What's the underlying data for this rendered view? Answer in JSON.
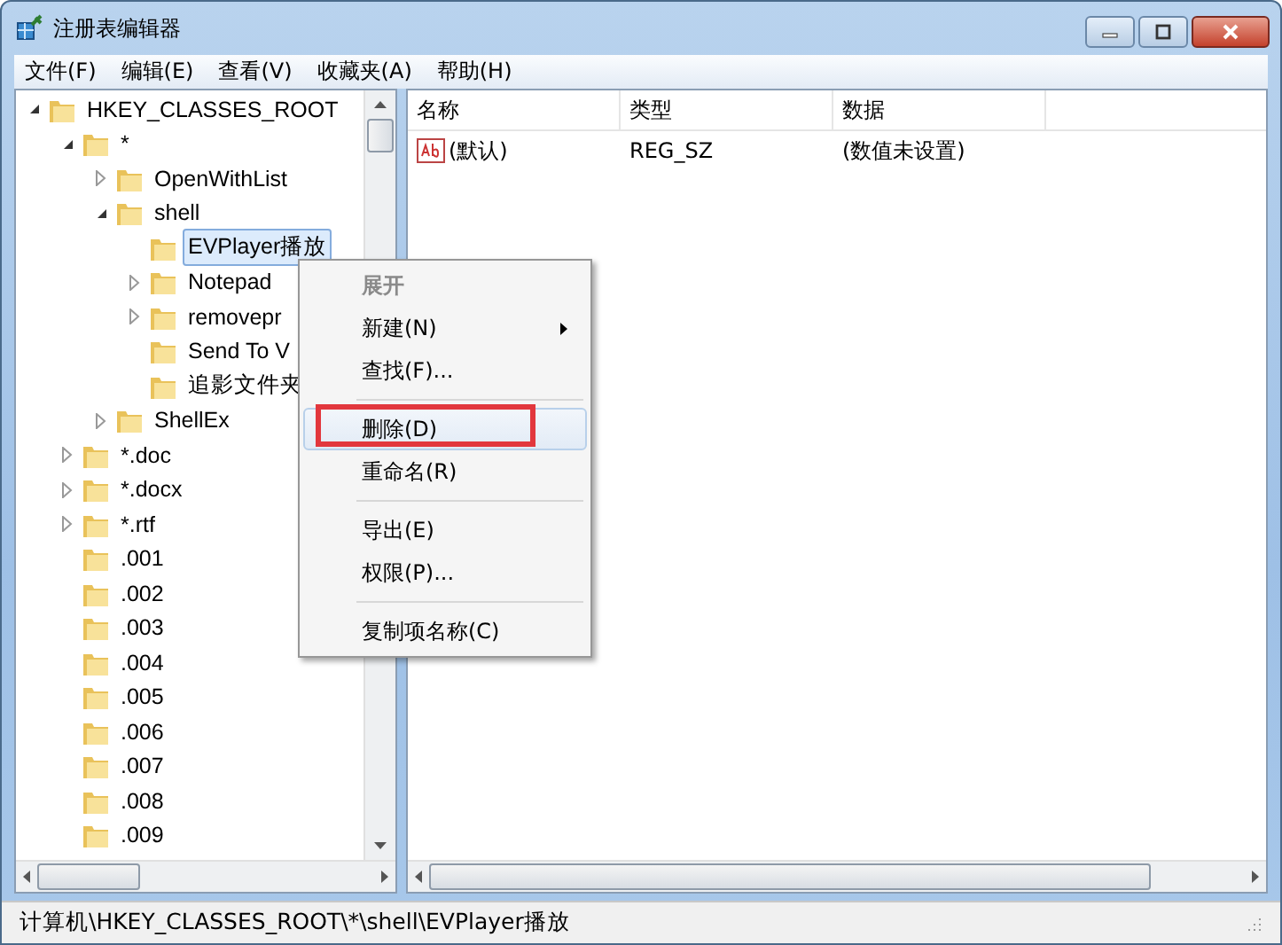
{
  "window": {
    "title": "注册表编辑器"
  },
  "menu_bar": [
    "文件(F)",
    "编辑(E)",
    "查看(V)",
    "收藏夹(A)",
    "帮助(H)"
  ],
  "tree": [
    {
      "label": "HKEY_CLASSES_ROOT",
      "has_subkeys": true,
      "expanded": true,
      "selected": false,
      "children": [
        {
          "label": "*",
          "has_subkeys": true,
          "expanded": true,
          "selected": false,
          "children": [
            {
              "label": "OpenWithList",
              "has_subkeys": true,
              "expanded": false,
              "selected": false
            },
            {
              "label": "shell",
              "has_subkeys": true,
              "expanded": true,
              "selected": false,
              "children": [
                {
                  "label": "EVPlayer播放",
                  "has_subkeys": false,
                  "expanded": false,
                  "selected": true
                },
                {
                  "label": "Notepad",
                  "has_subkeys": true,
                  "expanded": false,
                  "selected": false
                },
                {
                  "label": "removepr",
                  "has_subkeys": true,
                  "expanded": false,
                  "selected": false
                },
                {
                  "label": "Send To V",
                  "has_subkeys": false,
                  "expanded": false,
                  "selected": false
                },
                {
                  "label": "追影文件夹",
                  "has_subkeys": false,
                  "expanded": false,
                  "selected": false
                }
              ]
            },
            {
              "label": "ShellEx",
              "has_subkeys": true,
              "expanded": false,
              "selected": false
            }
          ]
        },
        {
          "label": "*.doc",
          "has_subkeys": true,
          "expanded": false,
          "selected": false
        },
        {
          "label": "*.docx",
          "has_subkeys": true,
          "expanded": false,
          "selected": false
        },
        {
          "label": "*.rtf",
          "has_subkeys": true,
          "expanded": false,
          "selected": false
        },
        {
          "label": ".001",
          "has_subkeys": false,
          "expanded": false,
          "selected": false
        },
        {
          "label": ".002",
          "has_subkeys": false,
          "expanded": false,
          "selected": false
        },
        {
          "label": ".003",
          "has_subkeys": false,
          "expanded": false,
          "selected": false
        },
        {
          "label": ".004",
          "has_subkeys": false,
          "expanded": false,
          "selected": false
        },
        {
          "label": ".005",
          "has_subkeys": false,
          "expanded": false,
          "selected": false
        },
        {
          "label": ".006",
          "has_subkeys": false,
          "expanded": false,
          "selected": false
        },
        {
          "label": ".007",
          "has_subkeys": false,
          "expanded": false,
          "selected": false
        },
        {
          "label": ".008",
          "has_subkeys": false,
          "expanded": false,
          "selected": false
        },
        {
          "label": ".009",
          "has_subkeys": false,
          "expanded": false,
          "selected": false
        }
      ]
    }
  ],
  "values_table": {
    "columns": [
      "名称",
      "类型",
      "数据"
    ],
    "rows": [
      {
        "name": "(默认)",
        "type": "REG_SZ",
        "data": "(数值未设置)"
      }
    ]
  },
  "context_menu": [
    {
      "kind": "item",
      "label": "展开",
      "default": true,
      "disabled": true,
      "submenu": false,
      "selected": false,
      "outlined": false
    },
    {
      "kind": "item",
      "label": "新建(N)",
      "default": false,
      "disabled": false,
      "submenu": true,
      "selected": false,
      "outlined": false
    },
    {
      "kind": "item",
      "label": "查找(F)...",
      "default": false,
      "disabled": false,
      "submenu": false,
      "selected": false,
      "outlined": false
    },
    {
      "kind": "separator"
    },
    {
      "kind": "item",
      "label": "删除(D)",
      "default": false,
      "disabled": false,
      "submenu": false,
      "selected": true,
      "outlined": true
    },
    {
      "kind": "item",
      "label": "重命名(R)",
      "default": false,
      "disabled": false,
      "submenu": false,
      "selected": false,
      "outlined": false
    },
    {
      "kind": "separator"
    },
    {
      "kind": "item",
      "label": "导出(E)",
      "default": false,
      "disabled": false,
      "submenu": false,
      "selected": false,
      "outlined": false
    },
    {
      "kind": "item",
      "label": "权限(P)...",
      "default": false,
      "disabled": false,
      "submenu": false,
      "selected": false,
      "outlined": false
    },
    {
      "kind": "separator"
    },
    {
      "kind": "item",
      "label": "复制项名称(C)",
      "default": false,
      "disabled": false,
      "submenu": false,
      "selected": false,
      "outlined": false
    }
  ],
  "status_bar": "计算机\\HKEY_CLASSES_ROOT\\*\\shell\\EVPlayer播放"
}
